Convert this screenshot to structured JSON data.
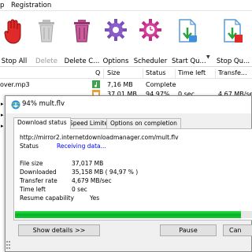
{
  "menu": {
    "items": [
      "p",
      "Registration"
    ]
  },
  "toolbar": {
    "buttons": [
      {
        "label": "Stop All",
        "icon": "hand-stop-icon"
      },
      {
        "label": "Delete",
        "icon": "trash-icon"
      },
      {
        "label": "Delete C...",
        "icon": "trash-completed-icon"
      },
      {
        "label": "Options",
        "icon": "gear-icon"
      },
      {
        "label": "Scheduler",
        "icon": "scheduler-icon"
      },
      {
        "label": "Start Qu...",
        "icon": "start-queue-icon"
      },
      {
        "label": "Stop Qu...",
        "icon": "stop-queue-icon"
      }
    ]
  },
  "list": {
    "columns": [
      "Q",
      "Size",
      "Status",
      "Time left",
      "Transfe..."
    ],
    "rows": [
      {
        "name": "over.mp3",
        "size": "7,16  MB",
        "status": "Complete",
        "time_left": "",
        "transfer": ""
      },
      {
        "name": "",
        "size": "37,01  MB",
        "status": "94,97%",
        "time_left": "0 sec",
        "transfer": "4,67  MB/sec"
      }
    ]
  },
  "dialog": {
    "title": "94% mult.flv",
    "tabs": [
      "Download status",
      "Speed Limiter",
      "Options on completion"
    ],
    "url": "http://mirror2.internetdownloadmanager.com/mult.flv",
    "status_label": "Status",
    "status_value": "Receiving data...",
    "fields": [
      {
        "label": "File size",
        "value": "37,017  MB"
      },
      {
        "label": "Downloaded",
        "value": "35,158  MB   ( 94,97 % )"
      },
      {
        "label": "Transfer rate",
        "value": "4,679  MB/sec"
      },
      {
        "label": "Time left",
        "value": "0 sec"
      },
      {
        "label": "Resume capability",
        "value": "Yes"
      }
    ],
    "progress": 0.9497,
    "show_details": "Show details >>",
    "pause": "Pause",
    "cancel": "Can"
  },
  "colors": {
    "accent": "#0066cc",
    "progress": "#06b025",
    "status_blue": "#0000ff"
  }
}
